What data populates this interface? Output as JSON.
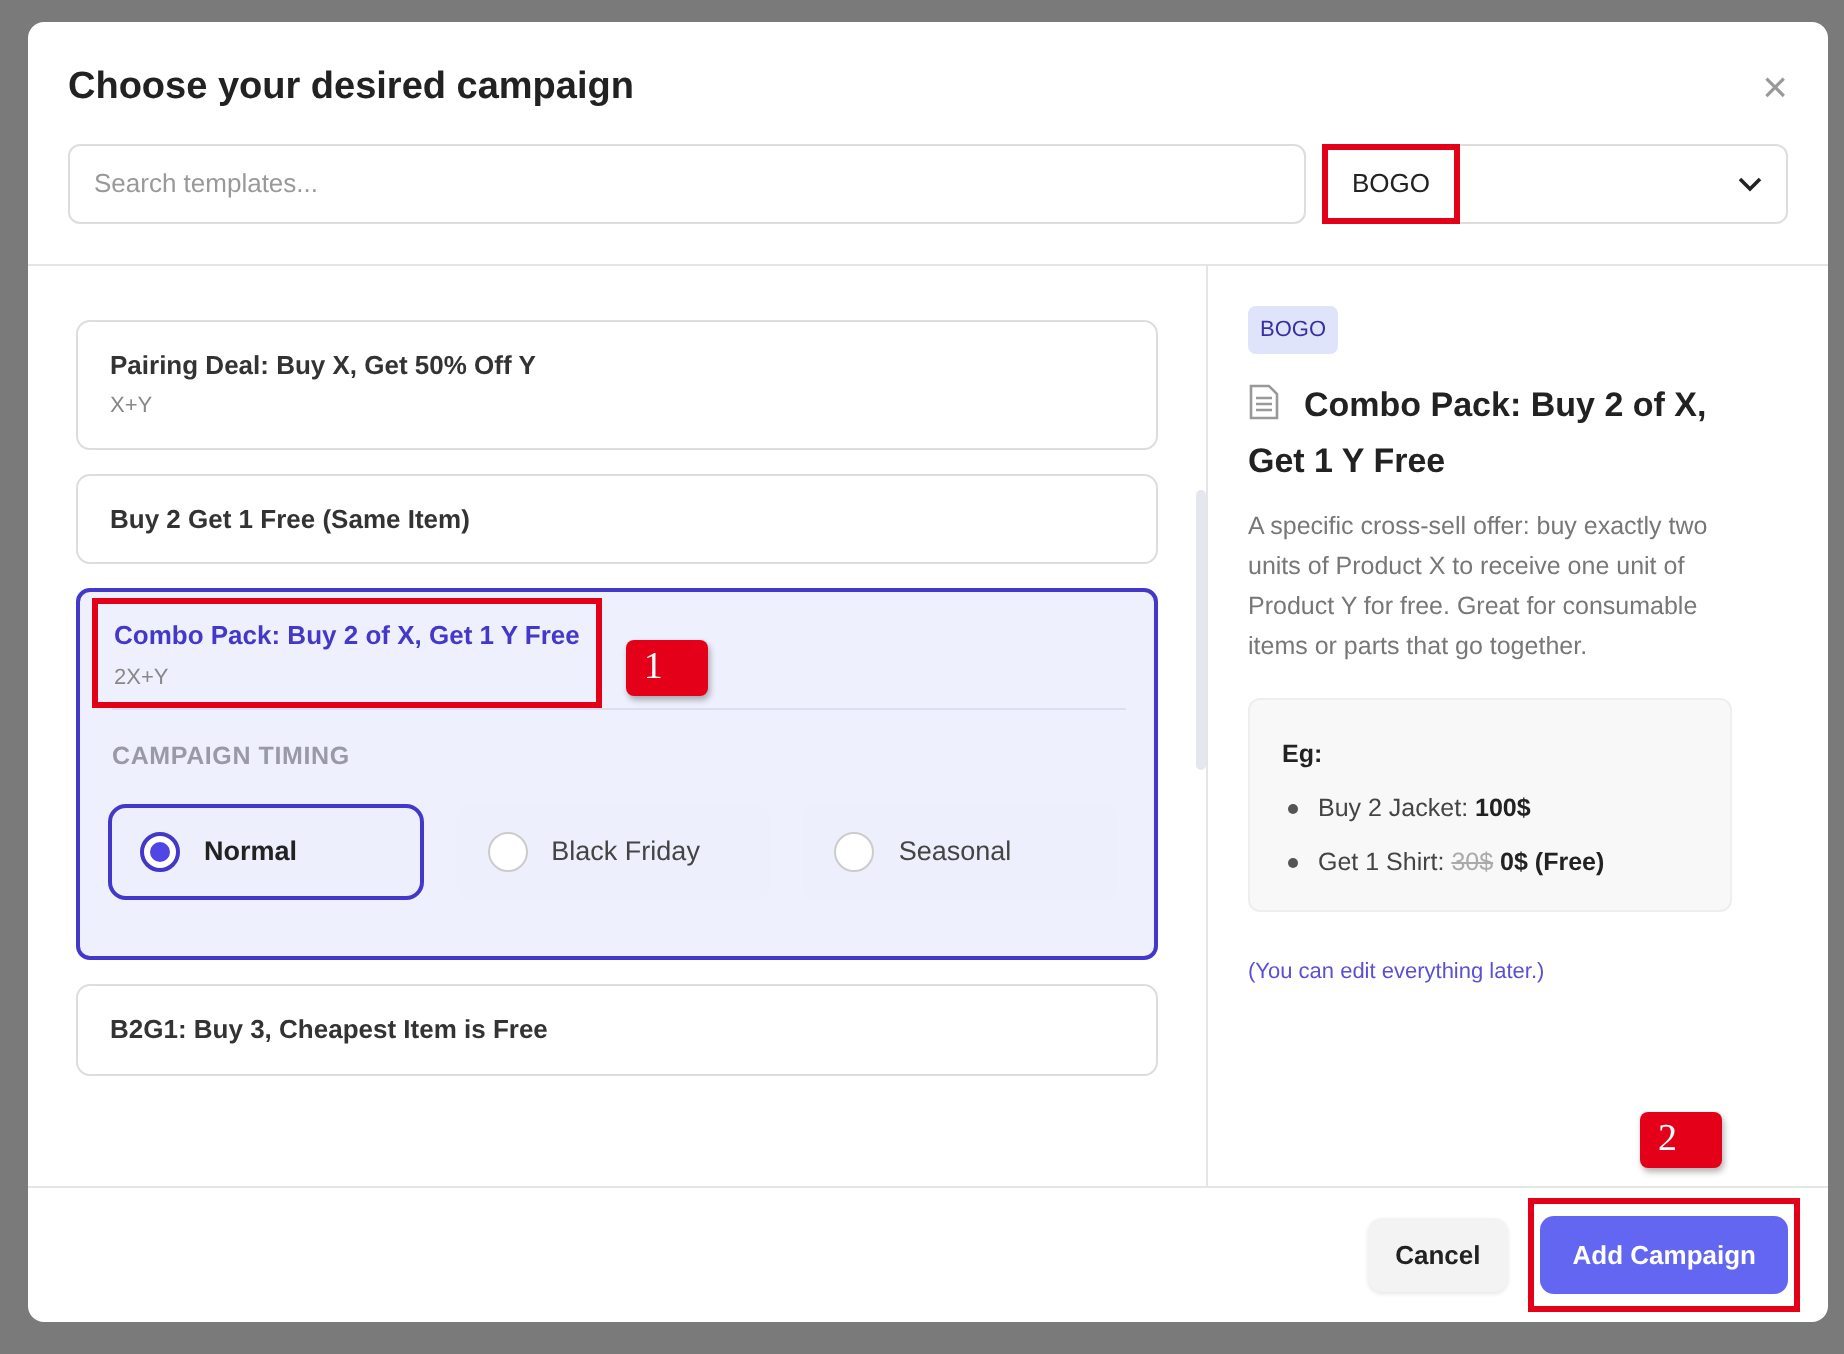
{
  "dialog": {
    "title": "Choose your desired campaign",
    "close": "×"
  },
  "search": {
    "placeholder": "Search templates..."
  },
  "filter": {
    "value": "BOGO",
    "highlighted": true
  },
  "templates": [
    {
      "title": "Pairing Deal: Buy X, Get 50% Off Y",
      "formula": "X+Y",
      "selected": false
    },
    {
      "title": "Buy 2 Get 1 Free (Same Item)",
      "selected": false
    },
    {
      "title": "Combo Pack: Buy 2 of X, Get 1 Y Free",
      "formula": "2X+Y",
      "selected": true,
      "highlighted": true,
      "callout": "1",
      "timing": {
        "label": "CAMPAIGN TIMING",
        "options": [
          {
            "label": "Normal",
            "selected": true
          },
          {
            "label": "Black Friday",
            "selected": false
          },
          {
            "label": "Seasonal",
            "selected": false
          }
        ]
      }
    },
    {
      "title": "B2G1: Buy 3, Cheapest Item is Free",
      "selected": false
    }
  ],
  "detail": {
    "tag": "BOGO",
    "title": "Combo Pack: Buy 2 of X, Get 1 Y Free",
    "description": "A specific cross-sell offer: buy exactly two units of Product X to receive one unit of Product Y for free. Great for consumable items or parts that go together.",
    "example": {
      "heading": "Eg:",
      "lines": [
        {
          "label": "Buy 2 Jacket:",
          "price": "100$"
        },
        {
          "label": "Get 1 Shirt:",
          "old_price": "30$",
          "price": "0$ (Free)"
        }
      ]
    },
    "note": "(You can edit everything later.)"
  },
  "footer": {
    "cancel": "Cancel",
    "confirm": {
      "label": "Add Campaign",
      "highlighted": true,
      "callout": "2"
    }
  }
}
